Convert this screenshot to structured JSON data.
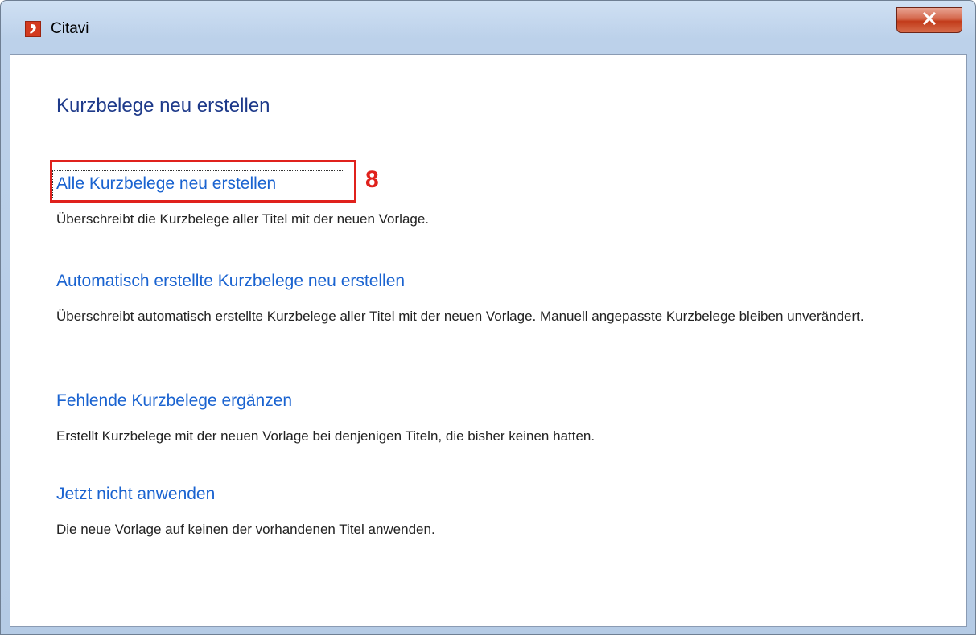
{
  "window": {
    "title": "Citavi",
    "icon": "citavi-app-icon",
    "close_icon": "close-icon"
  },
  "dialog": {
    "heading": "Kurzbelege neu erstellen",
    "options": [
      {
        "label": "Alle Kurzbelege neu erstellen",
        "description": "Überschreibt die Kurzbelege aller Titel mit der neuen Vorlage."
      },
      {
        "label": "Automatisch erstellte Kurzbelege neu erstellen",
        "description": "Überschreibt automatisch erstellte Kurzbelege aller Titel mit der neuen Vorlage. Manuell angepasste Kurzbelege bleiben unverändert."
      },
      {
        "label": "Fehlende Kurzbelege ergänzen",
        "description": "Erstellt Kurzbelege mit der neuen Vorlage bei denjenigen Titeln, die bisher keinen hatten."
      },
      {
        "label": "Jetzt nicht anwenden",
        "description": "Die neue Vorlage auf keinen der vorhandenen Titel anwenden."
      }
    ]
  },
  "annotation": {
    "step_number": "8",
    "color": "#e0211c"
  },
  "colors": {
    "link": "#1a63d0",
    "heading": "#1e3a8a",
    "text": "#222222"
  }
}
